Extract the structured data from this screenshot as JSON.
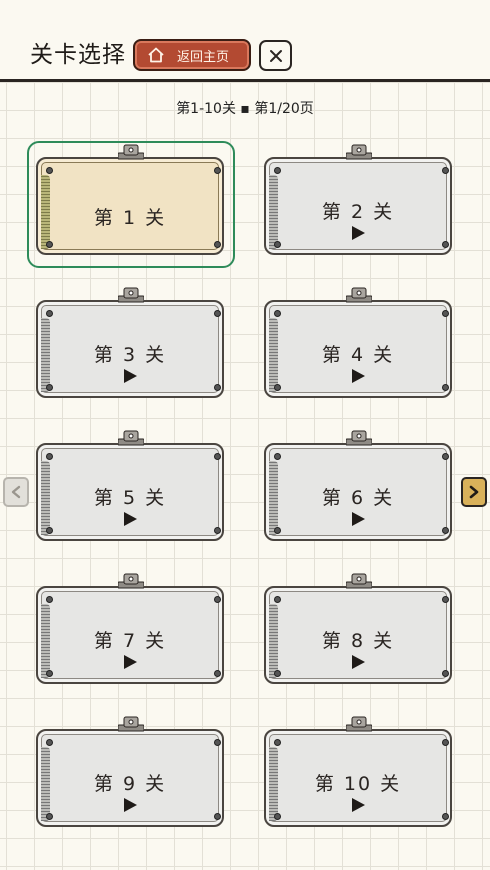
{
  "header": {
    "title": "关卡选择",
    "home_label": "返回主页",
    "home_icon": "home-icon",
    "close_icon": "close-icon"
  },
  "page_info": "第1-10关 ▪ 第1/20页",
  "levels": [
    {
      "label": "第 1 关",
      "selected": true
    },
    {
      "label": "第 2 关"
    },
    {
      "label": "第 3 关"
    },
    {
      "label": "第 4 关"
    },
    {
      "label": "第 5 关"
    },
    {
      "label": "第 6 关"
    },
    {
      "label": "第 7 关"
    },
    {
      "label": "第 8 关"
    },
    {
      "label": "第 9 关"
    },
    {
      "label": "第 10 关"
    }
  ],
  "nav": {
    "prev_icon": "chevron-left-icon",
    "next_icon": "chevron-right-icon"
  },
  "colors": {
    "accent_red": "#b34a32",
    "selected_green": "#2e8b5a",
    "next_yellow": "#d9b15a"
  }
}
